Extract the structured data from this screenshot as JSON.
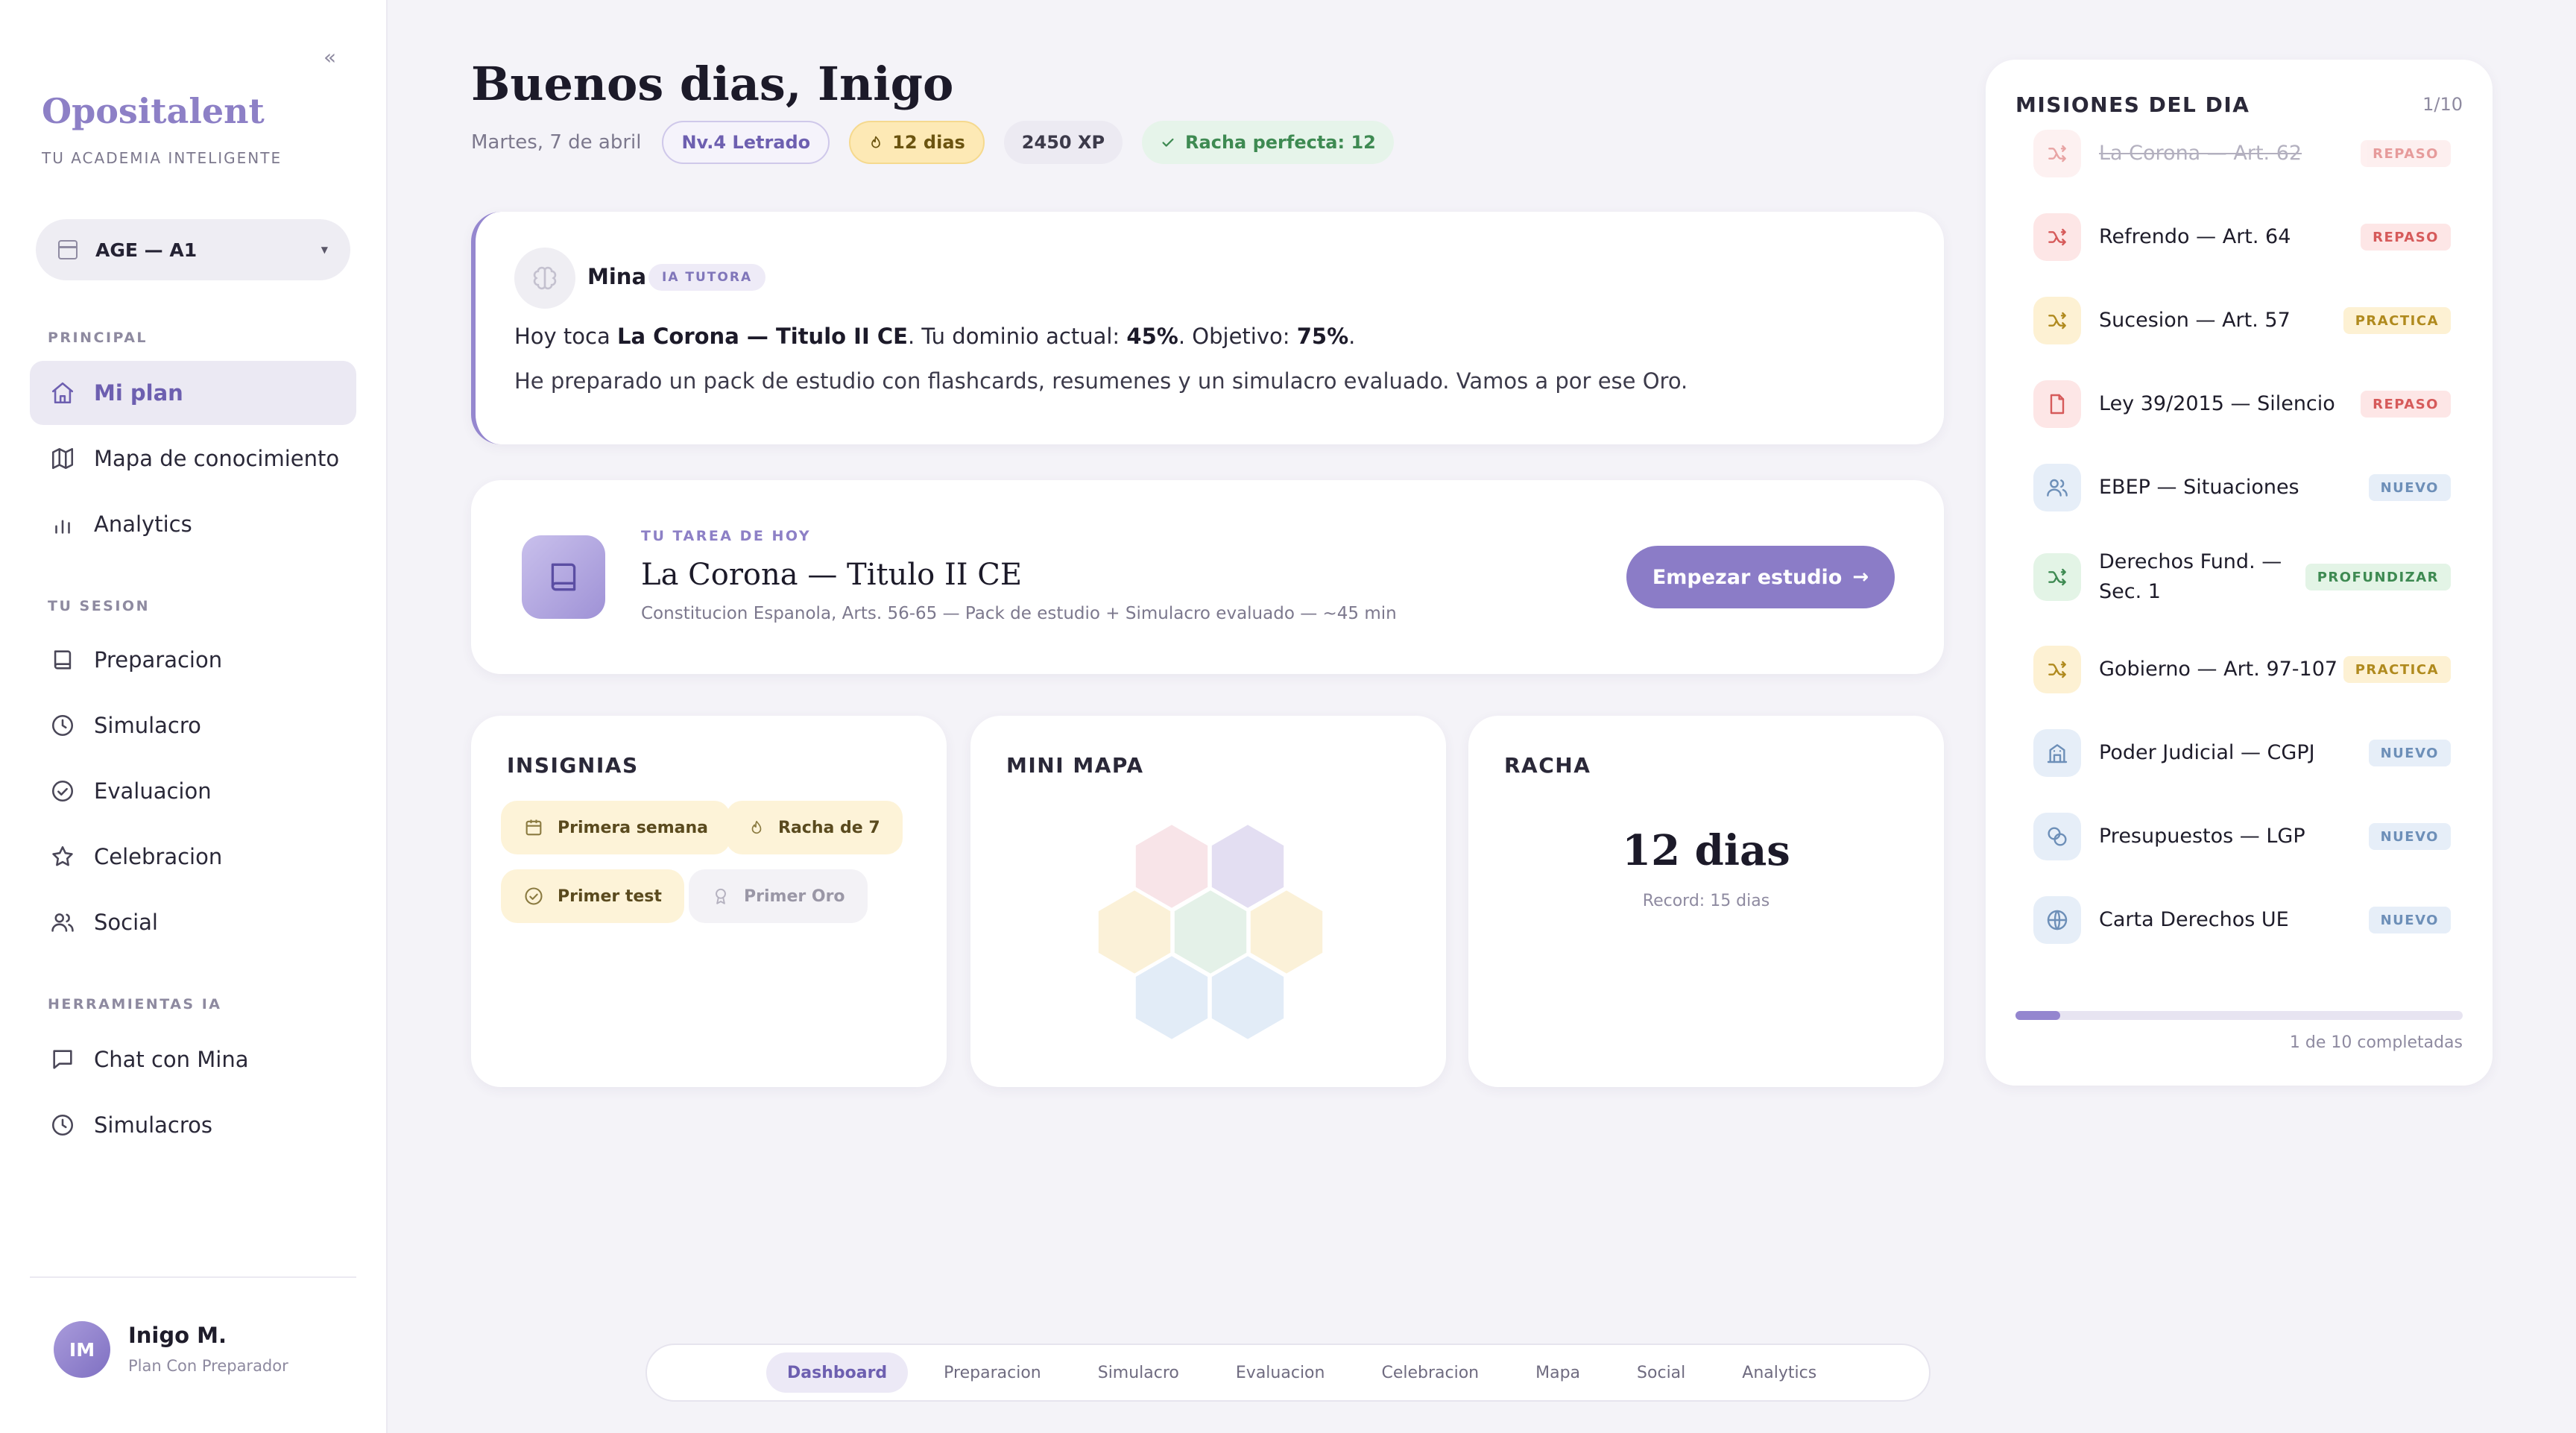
{
  "sidebar": {
    "collapse_glyph": "«",
    "brand": "Opositalent",
    "brand_sub": "TU ACADEMIA INTELIGENTE",
    "selector": "AGE — A1",
    "sections": [
      "PRINCIPAL",
      "TU SESION",
      "HERRAMIENTAS IA"
    ],
    "items": [
      {
        "label": "Mi plan",
        "icon": "home-icon"
      },
      {
        "label": "Mapa de conocimiento",
        "icon": "map-icon"
      },
      {
        "label": "Analytics",
        "icon": "bar-chart-icon"
      },
      {
        "label": "Preparacion",
        "icon": "book-icon"
      },
      {
        "label": "Simulacro",
        "icon": "clock-icon"
      },
      {
        "label": "Evaluacion",
        "icon": "check-circle-icon"
      },
      {
        "label": "Celebracion",
        "icon": "star-icon"
      },
      {
        "label": "Social",
        "icon": "users-icon"
      },
      {
        "label": "Chat con Mina",
        "icon": "chat-icon"
      },
      {
        "label": "Simulacros",
        "icon": "clock-icon"
      }
    ],
    "user": {
      "initials": "IM",
      "name": "Inigo M.",
      "plan": "Plan Con Preparador"
    }
  },
  "header": {
    "greeting": "Buenos dias, Inigo",
    "date": "Martes, 7 de abril",
    "level": "Nv.4 Letrado",
    "streak": "12 dias",
    "xp": "2450 XP",
    "perfect": "Racha perfecta: 12"
  },
  "mina": {
    "name": "Mina",
    "tag": "IA TUTORA",
    "line1_a": "Hoy toca ",
    "line1_topic": "La Corona — Titulo II CE",
    "line1_b": ". Tu dominio actual: ",
    "line1_dom": "45%",
    "line1_c": ". Objetivo: ",
    "line1_goal": "75%",
    "line1_d": ".",
    "line2": "He preparado un pack de estudio con flashcards, resumenes y un simulacro evaluado. Vamos a por ese Oro."
  },
  "task": {
    "kicker": "TU TAREA DE HOY",
    "title": "La Corona — Titulo II CE",
    "subtitle": "Constitucion Espanola, Arts. 56-65 — Pack de estudio + Simulacro evaluado — ~45 min",
    "button": "Empezar estudio"
  },
  "badges": {
    "title": "INSIGNIAS",
    "items": [
      {
        "label": "Primera semana",
        "icon": "calendar-icon",
        "earned": true
      },
      {
        "label": "Racha de 7",
        "icon": "flame-icon",
        "earned": true
      },
      {
        "label": "Primer test",
        "icon": "check-circle-icon",
        "earned": true
      },
      {
        "label": "Primer Oro",
        "icon": "medal-icon",
        "earned": false
      }
    ]
  },
  "minimap": {
    "title": "MINI MAPA",
    "colors": [
      "#f8e4e8",
      "#e3def2",
      "#fbf1d8",
      "#e4f1e8",
      "#fbf1d8",
      "#e2ecf7",
      "#e2ecf7"
    ]
  },
  "racha": {
    "title": "RACHA",
    "value": "12 dias",
    "record": "Record: 15 dias"
  },
  "missions": {
    "title": "MISIONES DEL DIA",
    "count": "1/10",
    "items": [
      {
        "label": "La Corona — Art. 62",
        "tag": "REPASO",
        "kind": "repaso",
        "icon": "shuffle-icon",
        "done": true
      },
      {
        "label": "Refrendo — Art. 64",
        "tag": "REPASO",
        "kind": "repaso",
        "icon": "shuffle-icon",
        "done": false
      },
      {
        "label": "Sucesion — Art. 57",
        "tag": "PRACTICA",
        "kind": "practica",
        "icon": "shuffle-icon",
        "done": false
      },
      {
        "label": "Ley 39/2015 — Silencio",
        "tag": "REPASO",
        "kind": "repaso",
        "icon": "document-icon",
        "done": false
      },
      {
        "label": "EBEP — Situaciones",
        "tag": "NUEVO",
        "kind": "nuevo",
        "icon": "users-icon",
        "done": false
      },
      {
        "label": "Derechos Fund. — Sec. 1",
        "tag": "PROFUNDIZAR",
        "kind": "prof",
        "icon": "shuffle-icon",
        "done": false
      },
      {
        "label": "Gobierno — Art. 97-107",
        "tag": "PRACTICA",
        "kind": "practica",
        "icon": "shuffle-icon",
        "done": false
      },
      {
        "label": "Poder Judicial — CGPJ",
        "tag": "NUEVO",
        "kind": "nuevo",
        "icon": "building-icon",
        "done": false
      },
      {
        "label": "Presupuestos — LGP",
        "tag": "NUEVO",
        "kind": "nuevo",
        "icon": "coins-icon",
        "done": false
      },
      {
        "label": "Carta Derechos UE",
        "tag": "NUEVO",
        "kind": "nuevo",
        "icon": "globe-icon",
        "done": false
      }
    ],
    "progress": 0.1,
    "progress_text": "1 de 10 completadas"
  },
  "bottom_nav": [
    "Dashboard",
    "Preparacion",
    "Simulacro",
    "Evaluacion",
    "Celebracion",
    "Mapa",
    "Social",
    "Analytics"
  ],
  "colors": {
    "accent": "#8b7cc7",
    "accent_dark": "#6d5fb0",
    "repaso": "#d65a5a",
    "practica": "#b08a1e",
    "nuevo": "#6d8fb8",
    "profundizar": "#3e8a52"
  }
}
